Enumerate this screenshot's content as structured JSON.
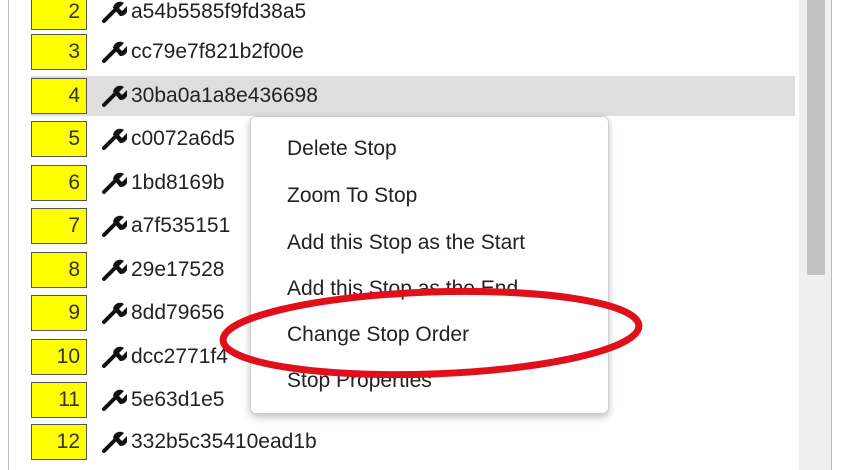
{
  "stops": [
    {
      "num": "2",
      "label": "a54b5585f9fd38a5"
    },
    {
      "num": "3",
      "label": "cc79e7f821b2f00e"
    },
    {
      "num": "4",
      "label": "30ba0a1a8e436698"
    },
    {
      "num": "5",
      "label": "c0072a6d5"
    },
    {
      "num": "6",
      "label": "1bd8169b"
    },
    {
      "num": "7",
      "label": "a7f535151"
    },
    {
      "num": "8",
      "label": "29e17528"
    },
    {
      "num": "9",
      "label": "8dd79656"
    },
    {
      "num": "10",
      "label": "dcc2771f4"
    },
    {
      "num": "11",
      "label": "5e63d1e5"
    },
    {
      "num": "12",
      "label": "332b5c35410ead1b"
    }
  ],
  "context_menu": {
    "items": [
      {
        "label": "Delete Stop"
      },
      {
        "label": "Zoom To Stop"
      },
      {
        "label": "Add this Stop as the Start"
      },
      {
        "label": "Add this Stop as the End"
      },
      {
        "label": "Change Stop Order"
      },
      {
        "label": "Stop Properties"
      }
    ]
  },
  "colors": {
    "stop_number_bg": "#ffff00",
    "selected_row_bg": "#dedede",
    "annotation_ring": "#e0101a"
  },
  "icons": {
    "stop_icon": "wrench-icon"
  }
}
